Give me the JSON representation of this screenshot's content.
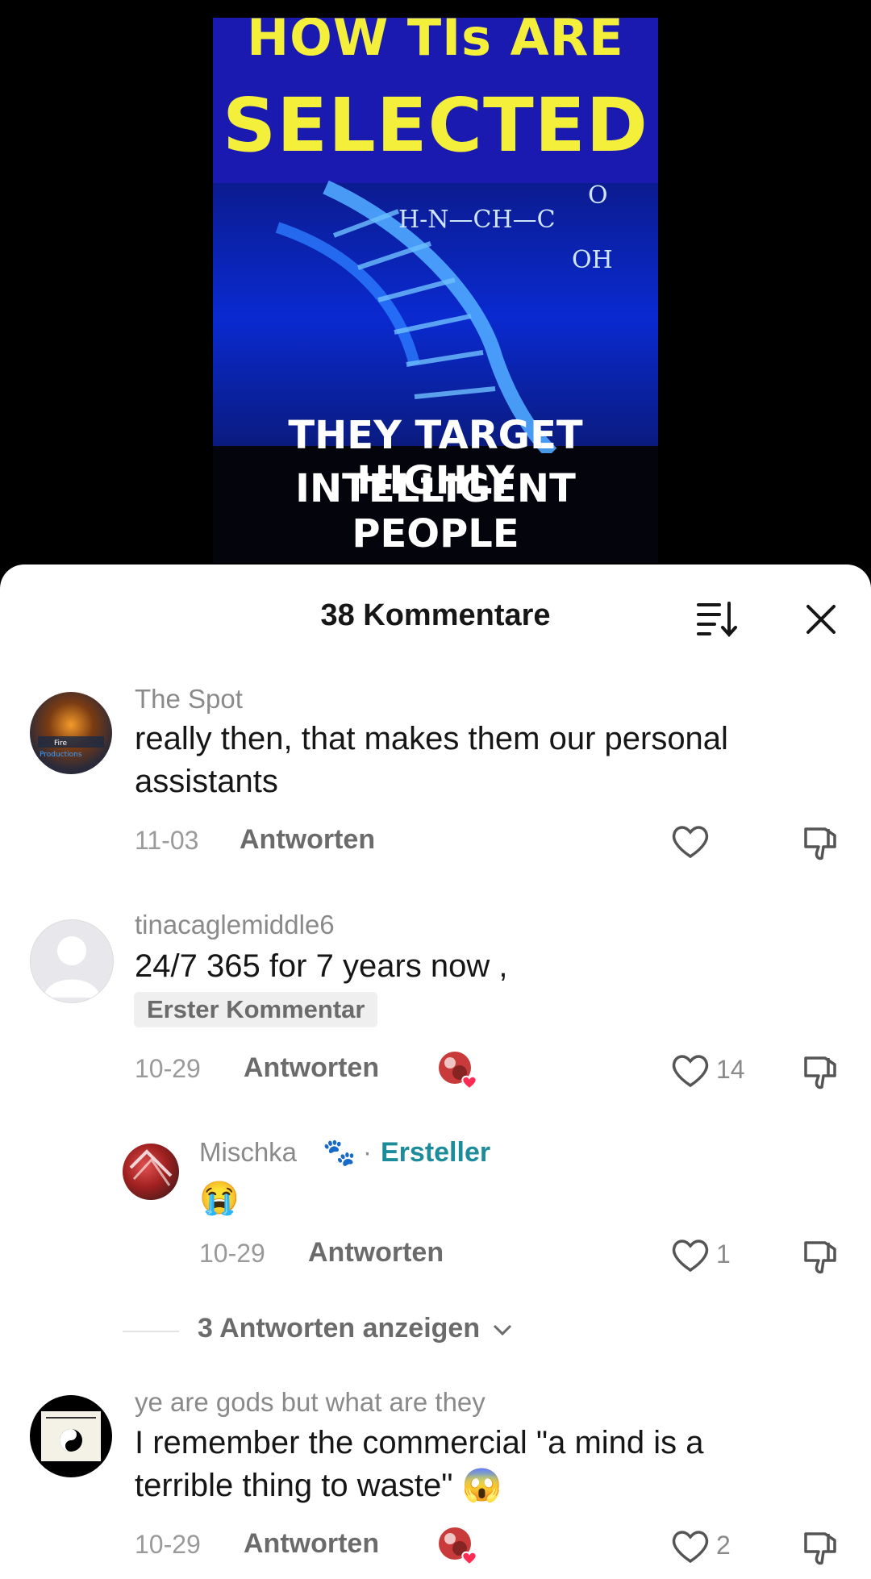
{
  "video": {
    "line1": "HOW TIs ARE",
    "line2": "SELECTED",
    "line3": "THEY TARGET HIGHLY",
    "line4": "INTELLIGENT PEOPLE"
  },
  "header": {
    "title": "38 Kommentare",
    "sort_icon": "sort-icon",
    "close_icon": "close-icon"
  },
  "comments": [
    {
      "username": "The Spot",
      "text": "really then, that makes them our personal assistants",
      "date": "11-03",
      "reply": "Antworten",
      "likes": ""
    },
    {
      "username": "tinacaglemiddle6",
      "text": "24/7 365 for 7 years now ,",
      "badge": "Erster Kommentar",
      "date": "10-29",
      "reply": "Antworten",
      "likes": "14"
    },
    {
      "username": "Mischka",
      "emoji": "🐾",
      "separator": "·",
      "creator": "Ersteller",
      "text": "😭",
      "date": "10-29",
      "reply": "Antworten",
      "likes": "1"
    },
    {
      "show_replies": "3 Antworten anzeigen"
    },
    {
      "username": "ye are gods but what are they",
      "text": "I remember the commercial \"a mind is a terrible thing to waste\" 😱",
      "date": "10-29",
      "reply": "Antworten",
      "likes": "2"
    }
  ],
  "colors": {
    "accent_creator": "#1c8c9a",
    "heart_red": "#fe2c55"
  }
}
